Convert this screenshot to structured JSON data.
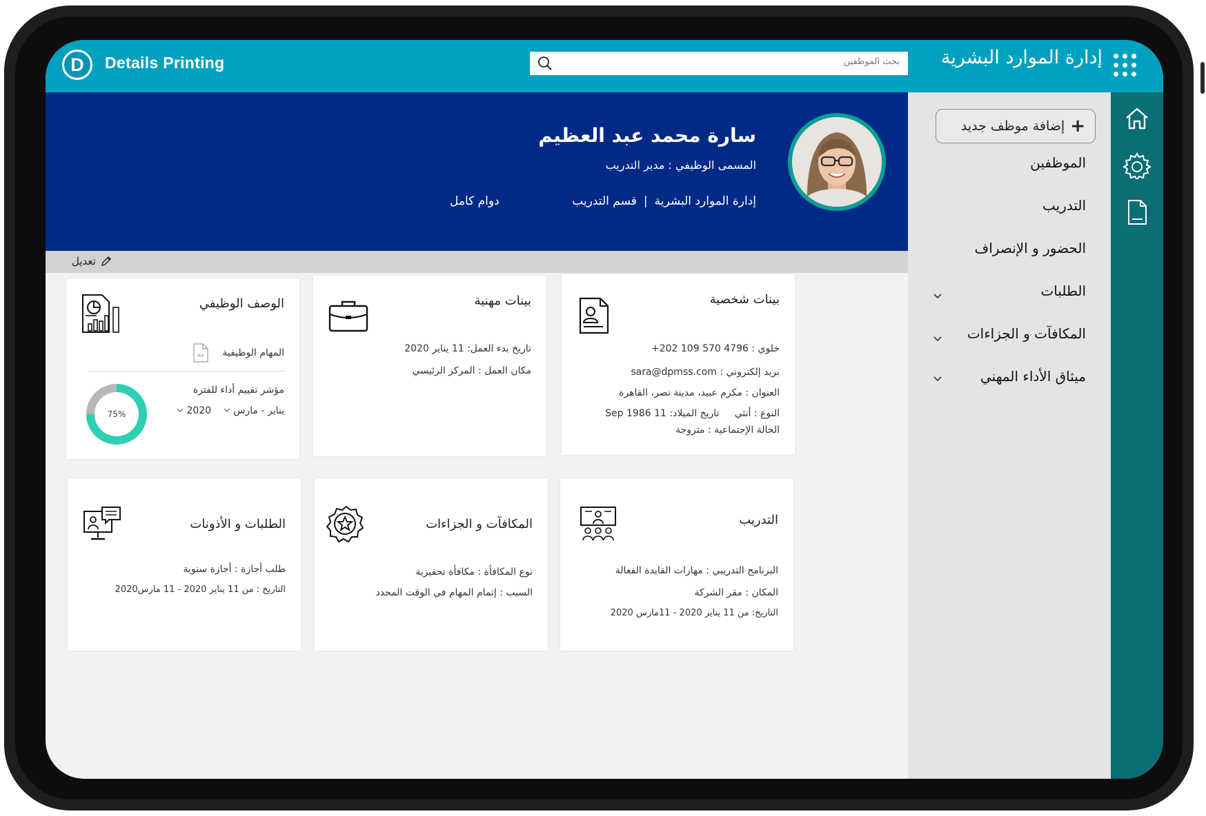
{
  "app": {
    "brand_letter": "D",
    "brand_name": "Details Printing",
    "title": "إدارة الموارد البشرية",
    "search_placeholder": "بحث الموظفين"
  },
  "sidebar": {
    "add_button": "إضافة موظف جديد",
    "items": [
      {
        "label": "الموظفين"
      },
      {
        "label": "التدريب"
      },
      {
        "label": "الحضور و الإنصراف"
      },
      {
        "label": "الطلبات"
      },
      {
        "label": "المكافآت و الجزاءات"
      },
      {
        "label": "ميثاق الأداء المهني"
      }
    ]
  },
  "rail_icons": [
    "home-icon",
    "gear-icon",
    "document-icon"
  ],
  "profile": {
    "name": "سارة محمد عبد العظيم",
    "job_title": "المسمى الوظيفي : مدير التدريب",
    "department": "إدارة الموارد البشرية",
    "division": "قسم التدريب",
    "work_type": "دوام كامل",
    "edit_label": "تعديل"
  },
  "cards": {
    "personal": {
      "title": "بينات شخصية",
      "mobile": "خلوي : 4796 570 109 202+",
      "email_label": "بريد إلكتروني :",
      "email": "sara@dpmss.com",
      "address": "العنوان : مكرم عبيد، مدينة نصر، القاهرة",
      "gender": "النوع : أنثي",
      "birth_label": "تاريخ الميلاد:",
      "birth_date": "11 Sep 1986",
      "marital": "الحالة الإجتماعية : متزوجة"
    },
    "professional": {
      "title": "بينات مهنية",
      "start_date": "تاريخ بدء العمل: 11 يناير 2020",
      "location": "مكان العمل : المركز الرئيسي"
    },
    "job_description": {
      "title": "الوصف الوظيفي",
      "tasks_label": "المهام الوظيفية",
      "pdf_label": "PDF",
      "kpi_label": "مؤشر تقييم أداء للفترة",
      "period_from": "يناير - مارس",
      "period_year": "2020",
      "progress_text": "75%",
      "progress_value": 0.75
    },
    "training": {
      "title": "التدريب",
      "program": "البرنامج التدريبي : مهارات القايدة الفعالة",
      "place": "المكان : مقر الشركة",
      "date": "التاريخ: من 11 يناير 2020 - 11مارس 2020"
    },
    "rewards": {
      "title": "المكافآت و الجزاءات",
      "type": "نوع المكافأة : مكافأة تحفيزية",
      "reason": "السبب : إتمام المهام في الوقت المحدد"
    },
    "requests": {
      "title": "الطلبات و الأذونات",
      "request": "طلب أجازة : أجازة سنوية",
      "date": "التاريخ : من 11 يناير 2020 - 11 مارس2020"
    }
  },
  "colors": {
    "header": "#00a1bf",
    "rail": "#0a6e74",
    "banner": "#002a85",
    "progress": "#2ecfb2",
    "progress_track": "#b7b7b7"
  }
}
